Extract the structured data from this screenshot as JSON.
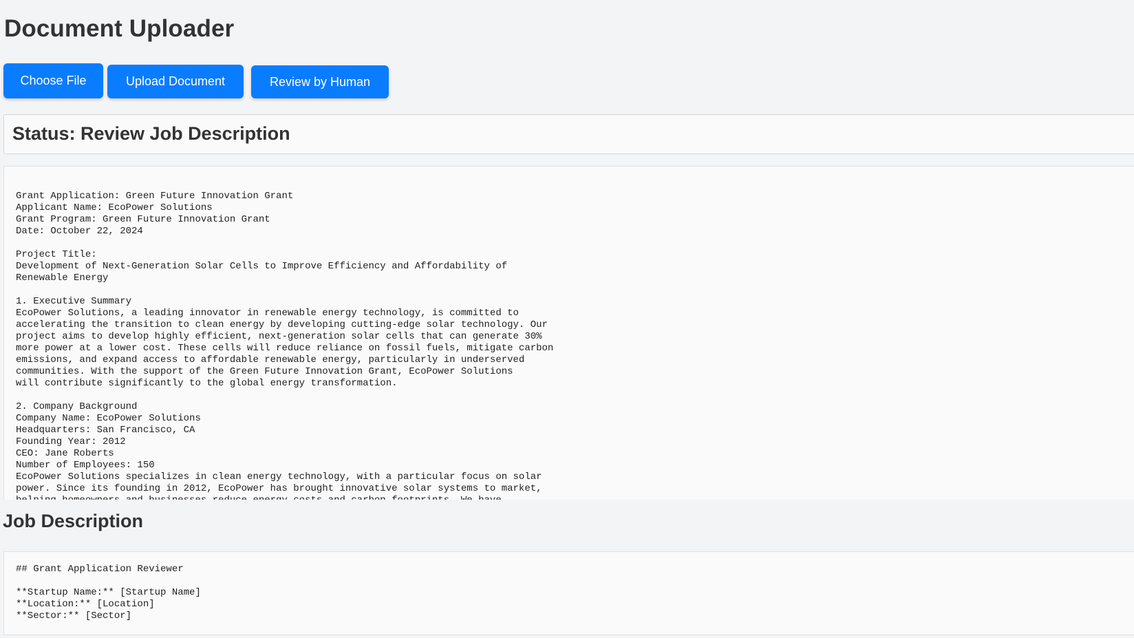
{
  "app": {
    "title": "Document Uploader"
  },
  "toolbar": {
    "choose_file_label": "Choose File",
    "upload_label": "Upload Document",
    "review_label": "Review by Human",
    "accent_color": "#0a7cff"
  },
  "status": {
    "text": "Status: Review Job Description"
  },
  "document": {
    "lines": [
      "Grant Application: Green Future Innovation Grant",
      "Applicant Name: EcoPower Solutions",
      "Grant Program: Green Future Innovation Grant",
      "Date: October 22, 2024",
      "",
      "Project Title:",
      "Development of Next-Generation Solar Cells to Improve Efficiency and Affordability of",
      "Renewable Energy",
      "",
      "1. Executive Summary",
      "EcoPower Solutions, a leading innovator in renewable energy technology, is committed to",
      "accelerating the transition to clean energy by developing cutting-edge solar technology. Our",
      "project aims to develop highly efficient, next-generation solar cells that can generate 30%",
      "more power at a lower cost. These cells will reduce reliance on fossil fuels, mitigate carbon",
      "emissions, and expand access to affordable renewable energy, particularly in underserved",
      "communities. With the support of the Green Future Innovation Grant, EcoPower Solutions",
      "will contribute significantly to the global energy transformation.",
      "",
      "2. Company Background",
      "Company Name: EcoPower Solutions",
      "Headquarters: San Francisco, CA",
      "Founding Year: 2012",
      "CEO: Jane Roberts",
      "Number of Employees: 150",
      "EcoPower Solutions specializes in clean energy technology, with a particular focus on solar",
      "power. Since its founding in 2012, EcoPower has brought innovative solar systems to market,",
      "helping homeowners and businesses reduce energy costs and carbon footprints. We have"
    ]
  },
  "job_description": {
    "heading": "Job Description",
    "lines": [
      "## Grant Application Reviewer",
      "",
      "**Startup Name:** [Startup Name]",
      "**Location:** [Location]",
      "**Sector:** [Sector]"
    ]
  }
}
